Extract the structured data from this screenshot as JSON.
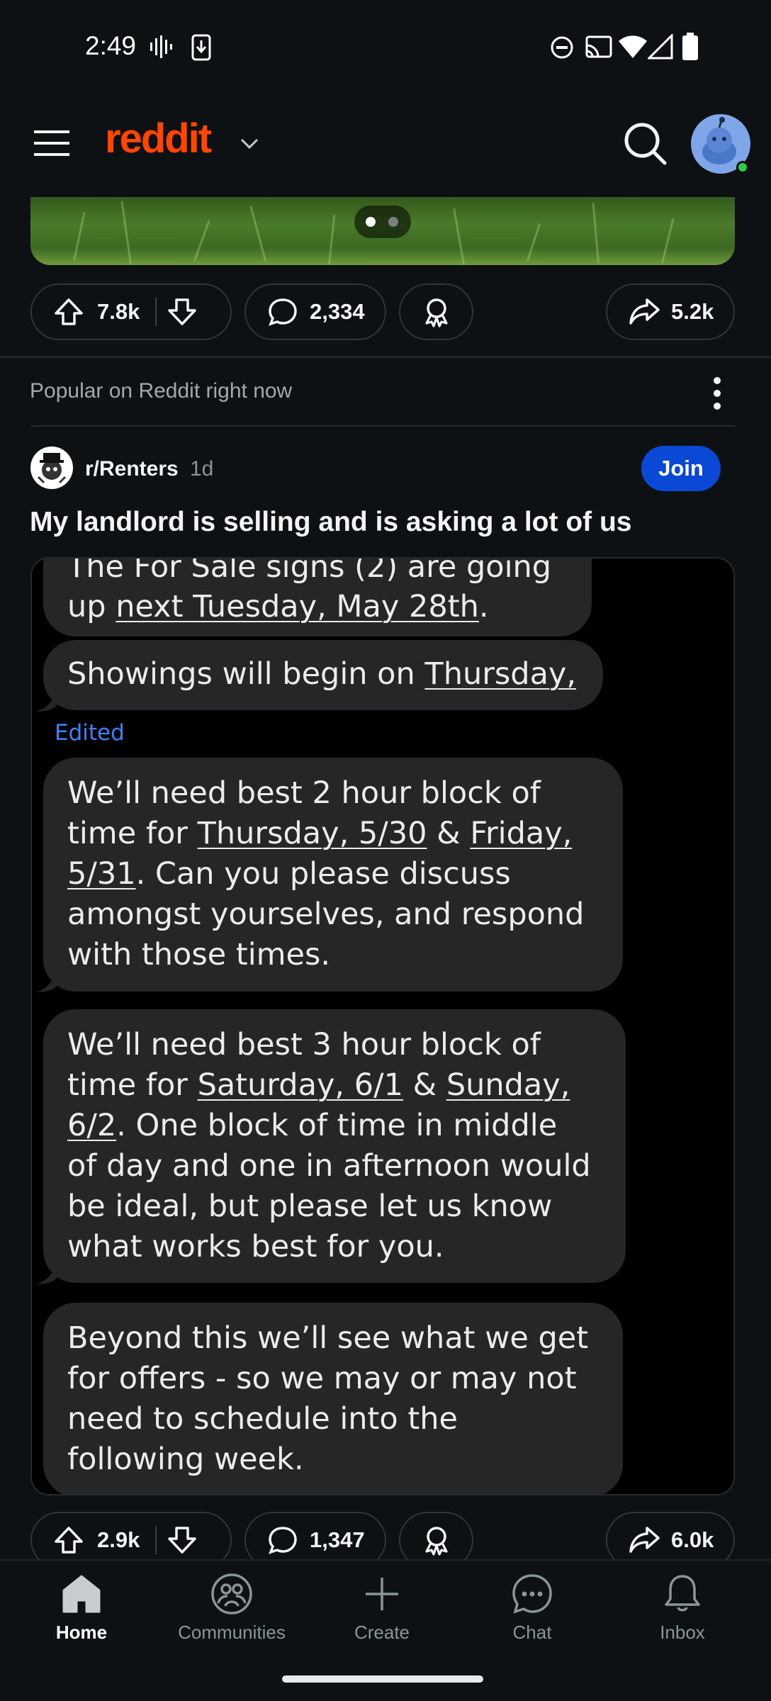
{
  "status_bar": {
    "time": "2:49"
  },
  "header": {
    "logo_text": "reddit"
  },
  "prev_post": {
    "upvotes": "7.8k",
    "comments": "2,334",
    "shares": "5.2k"
  },
  "feed_label": "Popular on Reddit right now",
  "post": {
    "subreddit": "r/Renters",
    "age": "1d",
    "join_label": "Join",
    "title": "My landlord is selling and is asking a lot of us",
    "messages": {
      "m1_partial": "The For Sale signs (2) are going",
      "m1_prefix": "up ",
      "m1_date": "next Tuesday, May 28th",
      "m1_suffix": ".",
      "m2_prefix": "Showings will begin on ",
      "m2_date": "Thursday,",
      "edited": "Edited",
      "m3_l1": "We’ll need best 2 hour block of",
      "m3_l2_prefix": "time for ",
      "m3_l2_date1": "Thursday, 5/30",
      "m3_l2_amp": " & ",
      "m3_l2_date2": "Friday,",
      "m3_l3_date": "5/31",
      "m3_l3_suffix": ".  Can you please discuss",
      "m3_l4": "amongst yourselves, and respond",
      "m3_l5": "with those times.",
      "m4_l1": "We’ll need best 3 hour block of",
      "m4_l2_prefix": "time for ",
      "m4_l2_date1": "Saturday, 6/1",
      "m4_l2_amp": " & ",
      "m4_l2_date2": "Sunday,",
      "m4_l3_date": "6/2",
      "m4_l3_suffix": ".  One block of time in middle",
      "m4_l4": "of day and one in afternoon would",
      "m4_l5": "be ideal, but please let us know",
      "m4_l6": "what works best for you.",
      "m5_l1": "Beyond this we’ll see what we get",
      "m5_l2": "for offers - so we may or may not",
      "m5_l3": "need to schedule into the",
      "m5_l4": "following week."
    },
    "upvotes": "2.9k",
    "comments": "1,347",
    "shares": "6.0k"
  },
  "bottom_nav": [
    {
      "label": "Home",
      "icon": "home-icon",
      "active": true
    },
    {
      "label": "Communities",
      "icon": "communities-icon"
    },
    {
      "label": "Create",
      "icon": "plus-icon"
    },
    {
      "label": "Chat",
      "icon": "chat-icon"
    },
    {
      "label": "Inbox",
      "icon": "bell-icon"
    }
  ],
  "colors": {
    "brand": "#ff4500",
    "join": "#0a49d5",
    "edited": "#3b82f6",
    "bubble": "#262628"
  }
}
